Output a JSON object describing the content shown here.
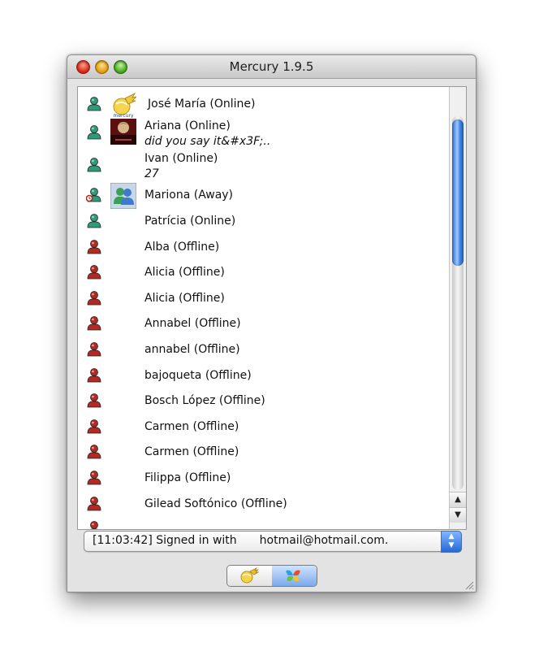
{
  "window": {
    "title": "Mercury 1.9.5"
  },
  "contacts": [
    {
      "name": "José María (Online)",
      "status": "online",
      "avatar": "mercury-logo-avatar",
      "message": ""
    },
    {
      "name": "Ariana (Online)",
      "status": "online",
      "avatar": "photo-avatar",
      "message": "did you say it&#x3F;.."
    },
    {
      "name": "Ivan (Online)",
      "status": "online",
      "avatar": "",
      "message": "27"
    },
    {
      "name": "Mariona (Away)",
      "status": "away",
      "avatar": "msn-people-avatar",
      "message": ""
    },
    {
      "name": "Patrícia (Online)",
      "status": "online",
      "avatar": "",
      "message": ""
    },
    {
      "name": "Alba (Offline)",
      "status": "offline",
      "avatar": "",
      "message": ""
    },
    {
      "name": "Alicia (Offline)",
      "status": "offline",
      "avatar": "",
      "message": ""
    },
    {
      "name": "Alicia (Offline)",
      "status": "offline",
      "avatar": "",
      "message": ""
    },
    {
      "name": "Annabel (Offline)",
      "status": "offline",
      "avatar": "",
      "message": ""
    },
    {
      "name": "annabel (Offline)",
      "status": "offline",
      "avatar": "",
      "message": ""
    },
    {
      "name": "bajoqueta (Offline)",
      "status": "offline",
      "avatar": "",
      "message": ""
    },
    {
      "name": "Bosch López (Offline)",
      "status": "offline",
      "avatar": "",
      "message": ""
    },
    {
      "name": "Carmen (Offline)",
      "status": "offline",
      "avatar": "",
      "message": ""
    },
    {
      "name": "Carmen (Offline)",
      "status": "offline",
      "avatar": "",
      "message": ""
    },
    {
      "name": "Filippa (Offline)",
      "status": "offline",
      "avatar": "",
      "message": ""
    },
    {
      "name": "Gilead Softónico (Offline)",
      "status": "offline",
      "avatar": "",
      "message": ""
    }
  ],
  "status_bar": {
    "time": "[11:03:42] Signed in with",
    "account": "hotmail@hotmail.com."
  },
  "footer": {
    "left_button_icon": "mercury-icon",
    "right_button_icon": "msn-butterfly-icon"
  },
  "colors": {
    "online": "#2f9a7a",
    "away": "#2f9a7a",
    "offline": "#b22a22",
    "scroll_thumb": "#3f82e0"
  }
}
